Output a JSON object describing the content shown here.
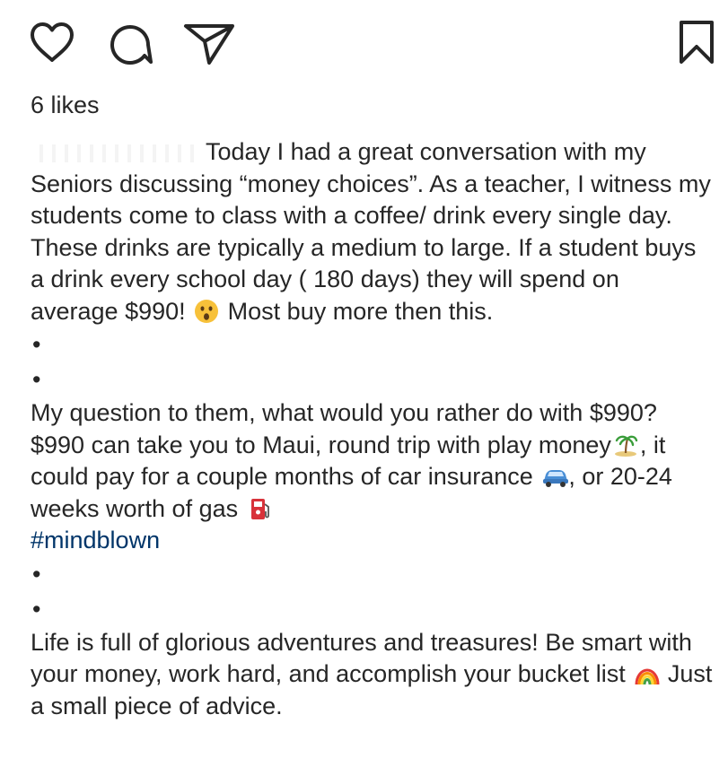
{
  "actions": {
    "like": "heart-icon",
    "comment": "comment-icon",
    "share": "paper-plane-icon",
    "save": "bookmark-icon"
  },
  "likes": "6 likes",
  "caption": {
    "p1": {
      "text": "Today I had a great conversation with my Seniors discussing “money choices”. As a teacher, I witness my students come to class with a coffee/ drink every single day. These drinks are typically a medium to large. If a student buys a drink every school day ( 180 days) they will spend on average $990!",
      "after_emoji": "Most buy more then this."
    },
    "bullet": "•",
    "p2": {
      "a": "My question to them, what would you rather do with $990? $990 can take you to Maui, round trip with play money",
      "b": ", it could pay for a couple months of car insurance",
      "c": ", or 20-24 weeks worth of gas",
      "hashtag": "#mindblown"
    },
    "p3": {
      "a": "Life is full of glorious adventures and treasures! Be smart with your money, work hard, and accomplish your bucket list",
      "b": "Just a small piece of advice."
    }
  },
  "colors": {
    "text": "#262626",
    "hashtag": "#003569",
    "background": "#ffffff"
  }
}
